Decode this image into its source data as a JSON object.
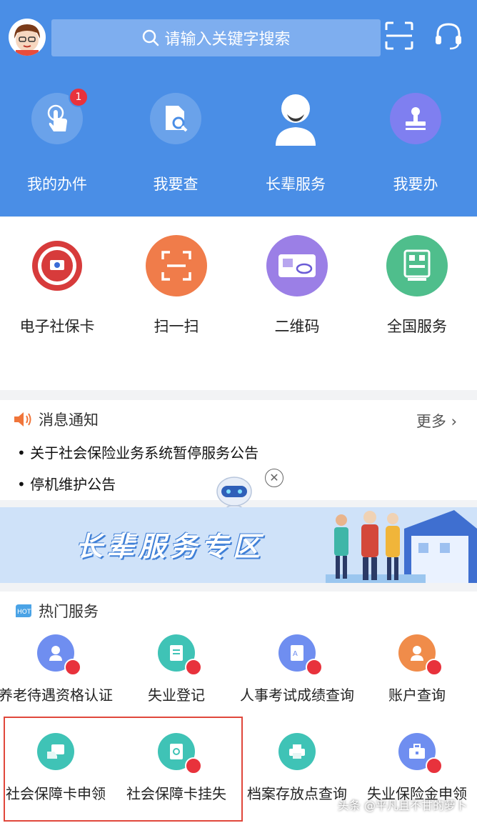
{
  "search": {
    "placeholder": "请输入关键字搜索"
  },
  "quick_actions": [
    {
      "label": "我的办件",
      "icon": "hand-tap-icon",
      "badge": "1"
    },
    {
      "label": "我要查",
      "icon": "document-search-icon"
    },
    {
      "label": "长辈服务",
      "icon": "elder-icon"
    },
    {
      "label": "我要办",
      "icon": "stamp-icon"
    }
  ],
  "services": [
    {
      "label": "电子社保卡",
      "icon": "social-security-card-icon",
      "color": "#ffffff"
    },
    {
      "label": "扫一扫",
      "icon": "scan-icon",
      "color": "#f07c4a"
    },
    {
      "label": "二维码",
      "icon": "card-icon",
      "color": "#9b7fe6"
    },
    {
      "label": "全国服务",
      "icon": "qrcode-icon",
      "color": "#4fbe8c"
    }
  ],
  "notice": {
    "title": "消息通知",
    "more": "更多 ›",
    "items": [
      "• 关于社会保险业务系统暂停服务公告",
      "• 停机维护公告"
    ]
  },
  "banner": {
    "title": "长辈服务专区"
  },
  "hot": {
    "title": "热门服务",
    "items": [
      {
        "label": "养老待遇资格认证",
        "icon": "pension-icon",
        "color": "#6f8ef0"
      },
      {
        "label": "失业登记",
        "icon": "form-icon",
        "color": "#3fc3b6"
      },
      {
        "label": "人事考试成绩查询",
        "icon": "exam-icon",
        "color": "#6f8ef0"
      },
      {
        "label": "账户查询",
        "icon": "user-icon",
        "color": "#f08c4a"
      },
      {
        "label": "社会保障卡申领",
        "icon": "card-apply-icon",
        "color": "#3fc3b6"
      },
      {
        "label": "社会保障卡挂失",
        "icon": "card-lock-icon",
        "color": "#3fc3b6"
      },
      {
        "label": "档案存放点查询",
        "icon": "printer-icon",
        "color": "#3fc3b6"
      },
      {
        "label": "失业保险金申领",
        "icon": "briefcase-icon",
        "color": "#6f8ef0"
      }
    ]
  },
  "watermark": "头条 @平凡且不甘的萝卜"
}
